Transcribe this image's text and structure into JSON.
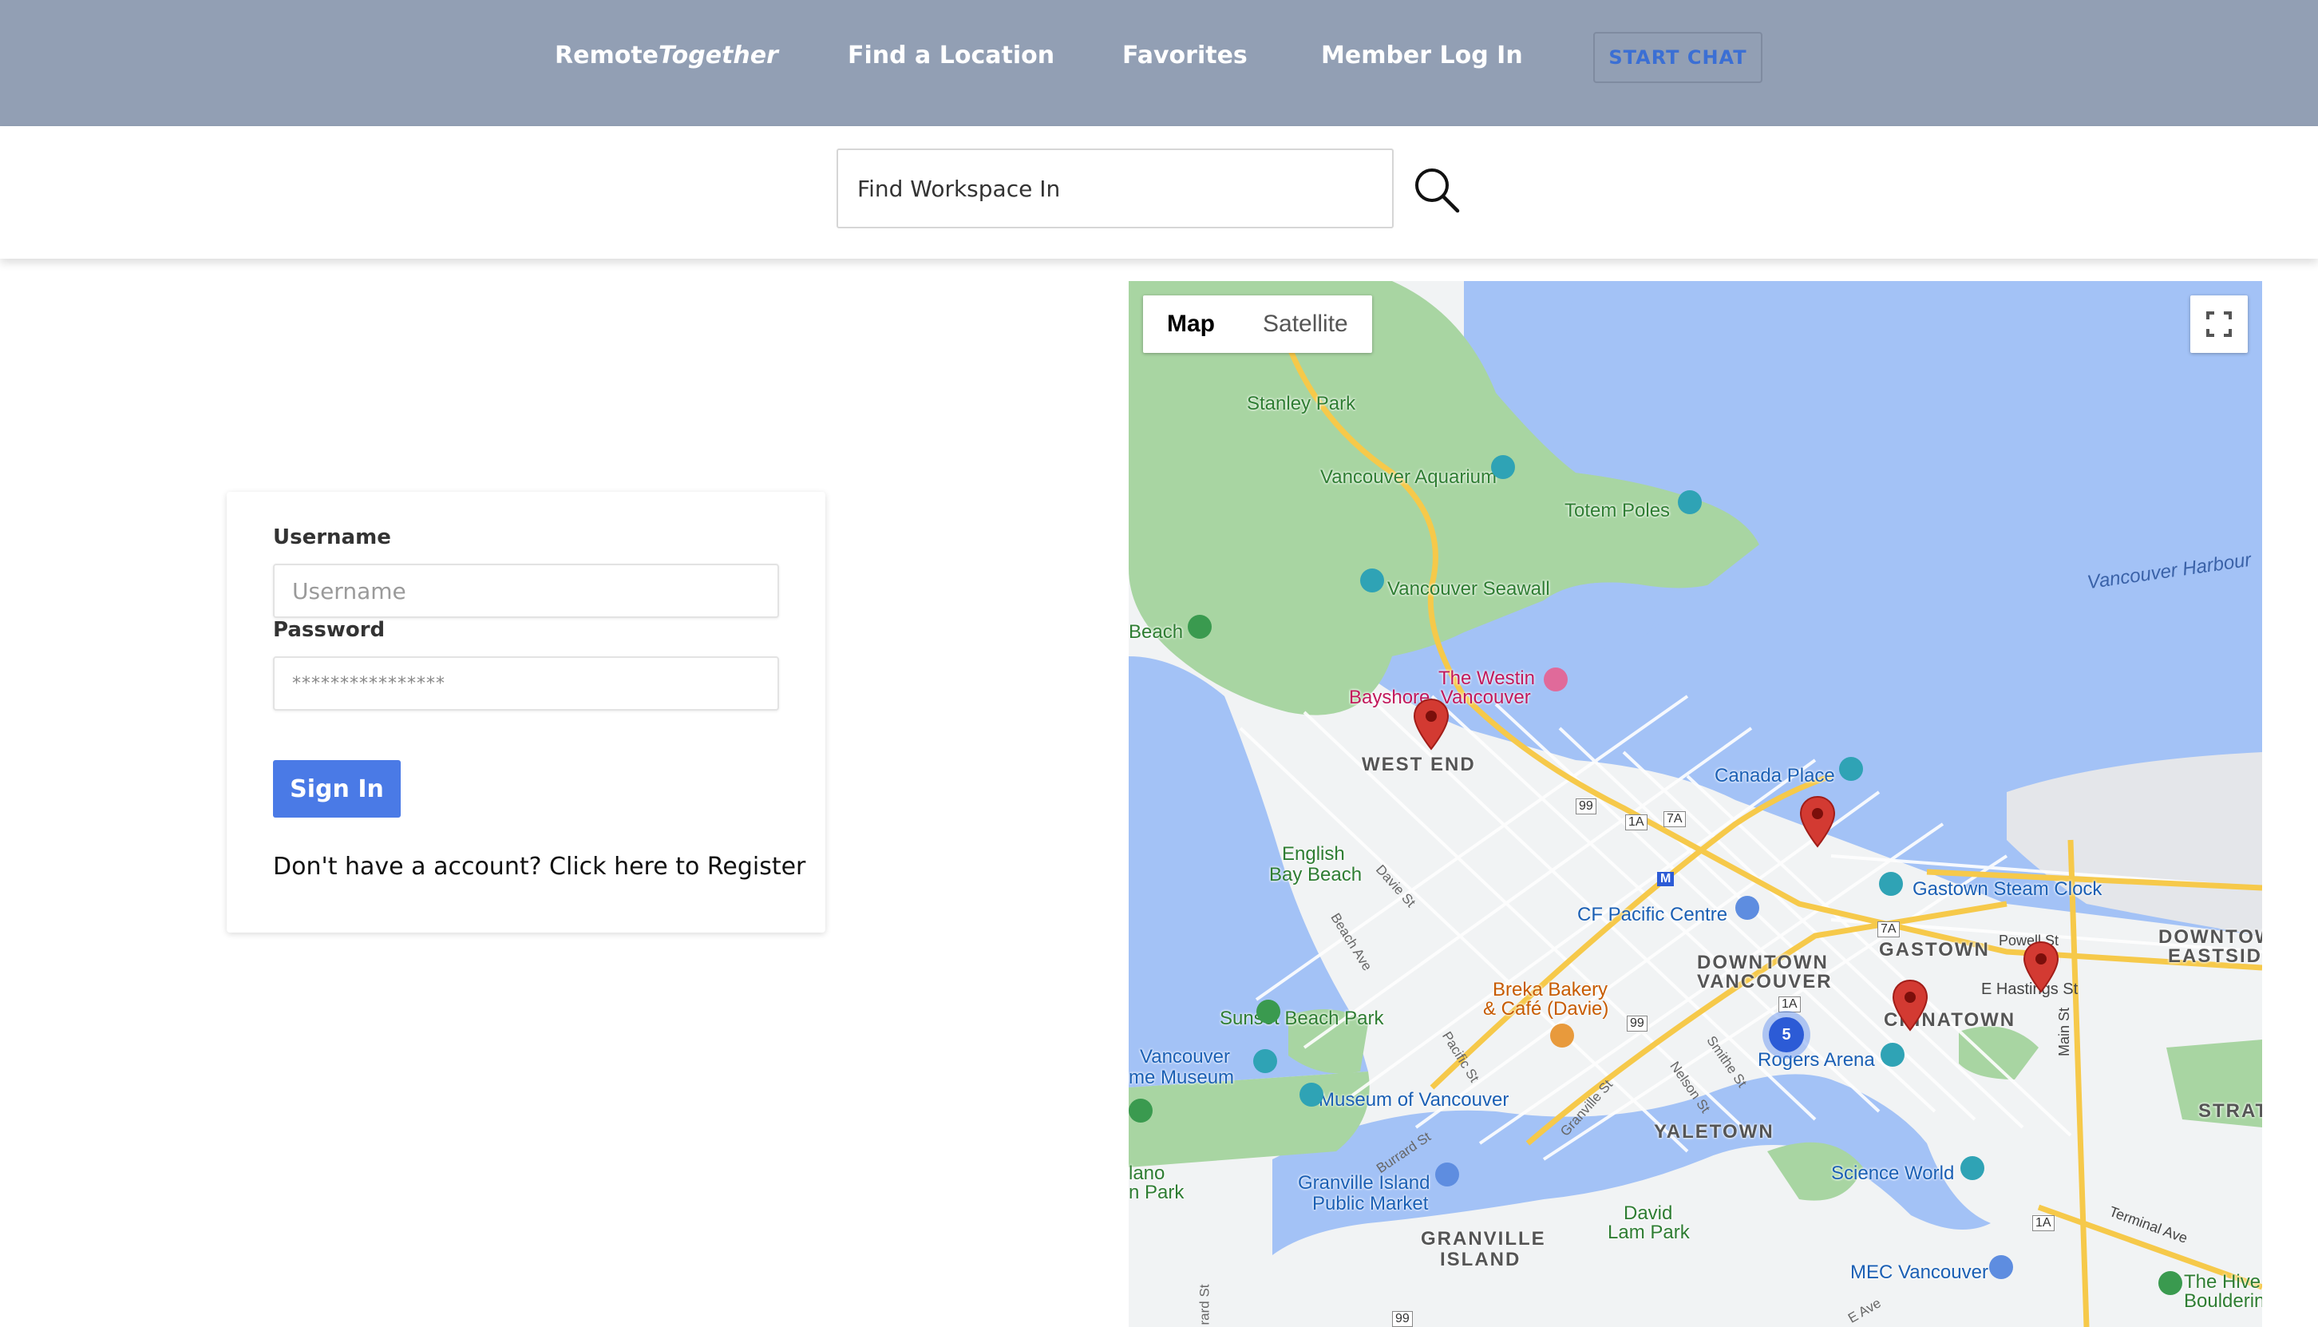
{
  "nav": {
    "brand_regular": "Remote",
    "brand_italic": "Together",
    "find_location": "Find a Location",
    "favorites": "Favorites",
    "member_login": "Member Log In",
    "start_chat": "START CHAT"
  },
  "search": {
    "placeholder": "Find Workspace In"
  },
  "login": {
    "username_label": "Username",
    "username_placeholder": "Username",
    "password_label": "Password",
    "password_value": "****************",
    "signin_label": "Sign In",
    "register_text": "Don't have a account? Click here to Register"
  },
  "map": {
    "type_map": "Map",
    "type_satellite": "Satellite",
    "cluster_count": "5",
    "labels": {
      "stanley_park": "Stanley Park",
      "aquarium": "Vancouver Aquarium",
      "totem_poles": "Totem Poles",
      "seawall": "Vancouver Seawall",
      "harbour": "Vancouver Harbour",
      "beach": "Beach",
      "westin_1": "The Westin",
      "westin_2": "Bayshore, Vancouver",
      "west_end": "WEST END",
      "canada_place": "Canada Place",
      "english_bay_1": "English",
      "english_bay_2": "Bay Beach",
      "cf_pacific": "CF Pacific Centre",
      "gastown_clock": "Gastown Steam Clock",
      "gastown": "GASTOWN",
      "downtown_eastside_1": "DOWNTOW",
      "downtown_eastside_2": "EASTSID",
      "downtown_van_1": "DOWNTOWN",
      "downtown_van_2": "VANCOUVER",
      "breka_1": "Breka Bakery",
      "breka_2": "& Café (Davie)",
      "chinatown": "CHINATOWN",
      "rogers": "Rogers Arena",
      "sunset_beach": "Sunset Beach Park",
      "van_museum_1": "Vancouver",
      "van_museum_2": "me Museum",
      "museum_of_van": "Museum of Vancouver",
      "yaletown": "YALETOWN",
      "strath": "STRATH",
      "science_world": "Science World",
      "granville_market_1": "Granville Island",
      "granville_market_2": "Public Market",
      "lano_park_1": "lano",
      "lano_park_2": "n Park",
      "granville_island_1": "GRANVILLE",
      "granville_island_2": "ISLAND",
      "david_lam_1": "David",
      "david_lam_2": "Lam Park",
      "mec": "MEC Vancouver",
      "hive_1": "The Hive",
      "hive_2": "Boulderin",
      "hastings": "E Hastings St",
      "powell": "Powell St",
      "main_st": "Main St",
      "terminal": "Terminal Ave",
      "davie": "Davie St",
      "beach_ave": "Beach Ave",
      "pacific": "Pacific St",
      "burrard": "Burrard St",
      "granville_st": "Granville St",
      "smithe": "Smithe St",
      "nelson": "Nelson St",
      "rd_st": "rard St",
      "e_ave": "E Ave",
      "hwy99a": "99",
      "hwy99b": "99",
      "hwy99c": "99",
      "hwy1a_a": "1A",
      "hwy1a_b": "1A",
      "hwy1a_c": "1A",
      "hwy7a_a": "7A",
      "hwy7a_b": "7A",
      "metro_m": "M"
    }
  },
  "colors": {
    "nav_bg": "#929fb4",
    "accent_blue": "#4a7ae6",
    "chat_text": "#3b6fd4",
    "pin_red": "#d33a32",
    "water": "#a3c2f6",
    "park": "#a8d5a2",
    "land": "#f1f3f4"
  }
}
